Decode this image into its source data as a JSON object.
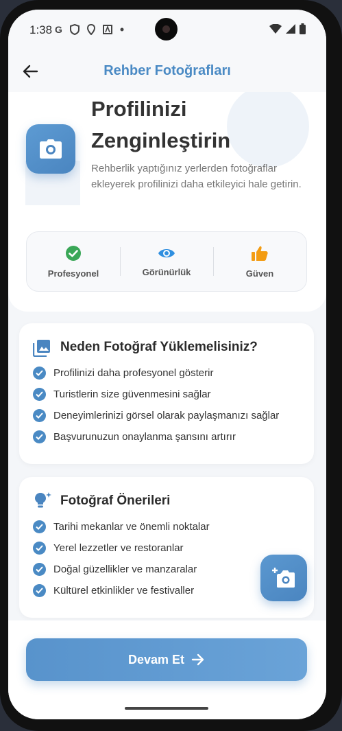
{
  "status_bar": {
    "time": "1:38"
  },
  "app_bar": {
    "title": "Rehber Fotoğrafları"
  },
  "hero": {
    "heading": "Profilinizi Zenginleştirin",
    "description": "Rehberlik yaptığınız yerlerden fotoğraflar ekleyerek profilinizi daha etkileyici hale getirin.",
    "features": [
      {
        "label": "Profesyonel",
        "icon": "check-circle-icon",
        "color": "#3aa757"
      },
      {
        "label": "Görünürlük",
        "icon": "eye-icon",
        "color": "#2f8fe0"
      },
      {
        "label": "Güven",
        "icon": "thumbs-up-icon",
        "color": "#f39c12"
      }
    ]
  },
  "why_card": {
    "title": "Neden Fotoğraf Yüklemelisiniz?",
    "items": [
      "Profilinizi daha profesyonel gösterir",
      "Turistlerin size güvenmesini sağlar",
      "Deneyimlerinizi görsel olarak paylaşmanızı sağlar",
      "Başvurunuzun onaylanma şansını artırır"
    ]
  },
  "tips_card": {
    "title": "Fotoğraf Önerileri",
    "items": [
      "Tarihi mekanlar ve önemli noktalar",
      "Yerel lezzetler ve restoranlar",
      "Doğal güzellikler ve manzaralar",
      "Kültürel etkinlikler ve festivaller"
    ]
  },
  "cta": {
    "label": "Devam Et"
  },
  "colors": {
    "accent": "#4a8ac4"
  }
}
